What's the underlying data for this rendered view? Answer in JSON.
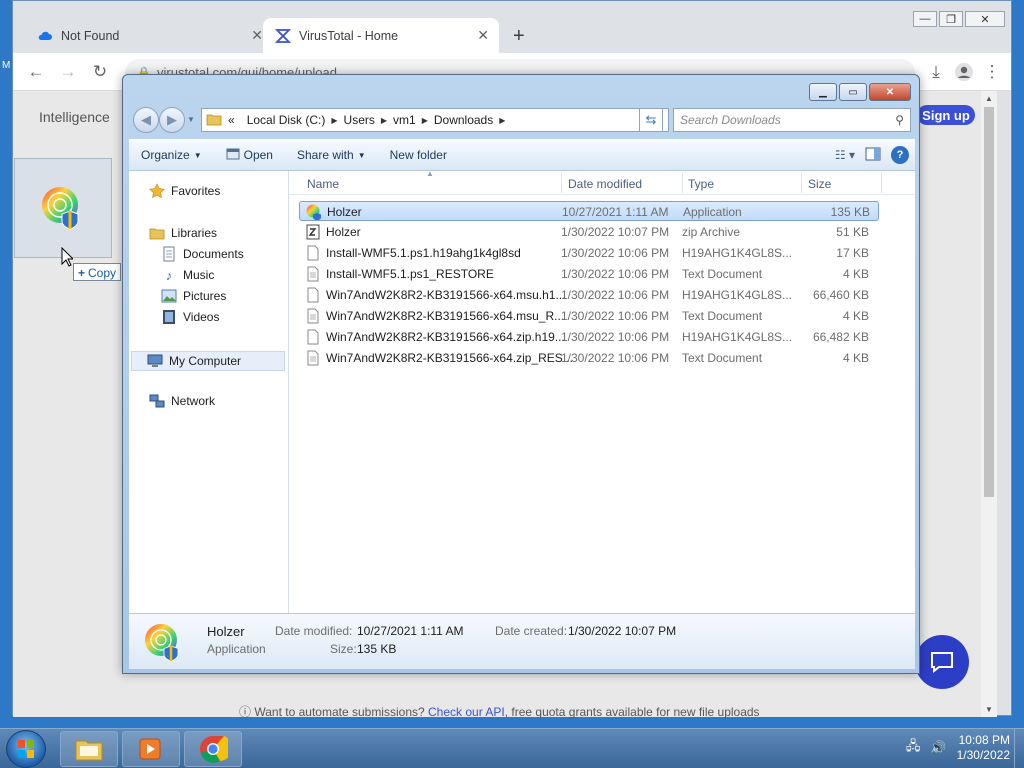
{
  "browser": {
    "tabs": [
      {
        "title": "Not Found"
      },
      {
        "title": "VirusTotal - Home"
      }
    ],
    "url": "virustotal.com/gui/home/upload",
    "page": {
      "intelligence_label": "Intelligence",
      "signup_label": "Sign up",
      "footer_text": "Want to automate submissions?",
      "footer_link": "Check our API",
      "footer_rest": ", free quota grants available for new file uploads"
    }
  },
  "drag": {
    "copy_label": "Copy"
  },
  "explorer": {
    "breadcrumbs": [
      "Local Disk (C:)",
      "Users",
      "vm1",
      "Downloads"
    ],
    "search_placeholder": "Search Downloads",
    "commands": {
      "organize": "Organize",
      "open": "Open",
      "share_with": "Share with",
      "new_folder": "New folder"
    },
    "nav": {
      "favorites": "Favorites",
      "libraries": "Libraries",
      "documents": "Documents",
      "music": "Music",
      "pictures": "Pictures",
      "videos": "Videos",
      "my_computer": "My Computer",
      "network": "Network"
    },
    "columns": {
      "name": "Name",
      "date": "Date modified",
      "type": "Type",
      "size": "Size"
    },
    "files": [
      {
        "name": "Holzer",
        "date": "10/27/2021 1:11 AM",
        "type": "Application",
        "size": "135 KB"
      },
      {
        "name": "Holzer",
        "date": "1/30/2022 10:07 PM",
        "type": "zip Archive",
        "size": "51 KB"
      },
      {
        "name": "Install-WMF5.1.ps1.h19ahg1k4gl8sd",
        "date": "1/30/2022 10:06 PM",
        "type": "H19AHG1K4GL8S...",
        "size": "17 KB"
      },
      {
        "name": "Install-WMF5.1.ps1_RESTORE",
        "date": "1/30/2022 10:06 PM",
        "type": "Text Document",
        "size": "4 KB"
      },
      {
        "name": "Win7AndW2K8R2-KB3191566-x64.msu.h1...",
        "date": "1/30/2022 10:06 PM",
        "type": "H19AHG1K4GL8S...",
        "size": "66,460 KB"
      },
      {
        "name": "Win7AndW2K8R2-KB3191566-x64.msu_R...",
        "date": "1/30/2022 10:06 PM",
        "type": "Text Document",
        "size": "4 KB"
      },
      {
        "name": "Win7AndW2K8R2-KB3191566-x64.zip.h19...",
        "date": "1/30/2022 10:06 PM",
        "type": "H19AHG1K4GL8S...",
        "size": "66,482 KB"
      },
      {
        "name": "Win7AndW2K8R2-KB3191566-x64.zip_RES...",
        "date": "1/30/2022 10:06 PM",
        "type": "Text Document",
        "size": "4 KB"
      }
    ],
    "details": {
      "name": "Holzer",
      "type": "Application",
      "date_modified_label": "Date modified:",
      "date_modified": "10/27/2021 1:11 AM",
      "date_created_label": "Date created:",
      "date_created": "1/30/2022 10:07 PM",
      "size_label": "Size:",
      "size": "135 KB"
    }
  },
  "taskbar": {
    "time": "10:08 PM",
    "date": "1/30/2022"
  },
  "colors": {
    "accent": "#3a50d6",
    "selection": "#c1dbfc",
    "taskbar": "#3a6798"
  }
}
